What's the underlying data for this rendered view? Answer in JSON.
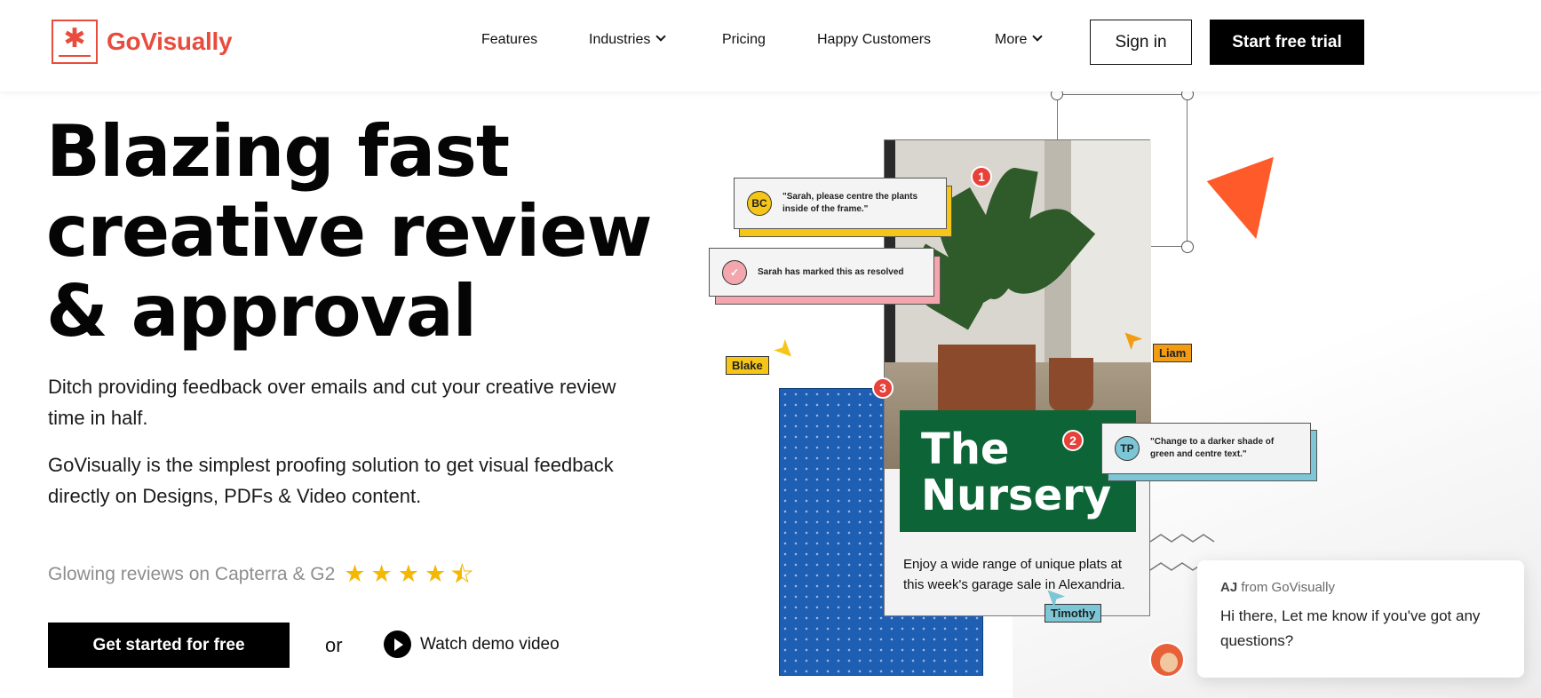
{
  "header": {
    "logo_text": "GoVisually",
    "logo_icon": "asterisk-logo-icon",
    "nav": [
      {
        "label": "Features",
        "dropdown": false
      },
      {
        "label": "Industries",
        "dropdown": true
      },
      {
        "label": "Pricing",
        "dropdown": false
      },
      {
        "label": "Happy Customers",
        "dropdown": false
      },
      {
        "label": "More",
        "dropdown": true
      }
    ],
    "signin_label": "Sign in",
    "trial_label": "Start free trial"
  },
  "hero": {
    "title_lines": [
      "Blazing fast",
      "creative review",
      "& approval"
    ],
    "paragraph_1": "Ditch providing feedback over emails and cut your creative review time in half.",
    "paragraph_2": "GoVisually is the simplest proofing solution to get visual feedback directly on Designs, PDFs & Video content.",
    "reviews_text": "Glowing reviews on Capterra & G2",
    "rating": 4.5,
    "rating_max": 5,
    "cta_primary": "Get started for free",
    "or_text": "or",
    "cta_video": "Watch demo video"
  },
  "illustration": {
    "comment_1": {
      "initials": "BC",
      "text": "\"Sarah, please centre the plants inside of the frame.\"",
      "badge": "1"
    },
    "comment_resolved": {
      "text": "Sarah has marked this as resolved"
    },
    "comment_2": {
      "initials": "TP",
      "text": "\"Change to a darker shade of green and centre text.\"",
      "badge": "2"
    },
    "badge_3": "3",
    "card_title": "The Nursery",
    "card_desc": "Enjoy a wide range of unique plats at this week's garage sale in Alexandria.",
    "tags": {
      "blake": "Blake",
      "liam": "Liam",
      "timothy": "Timothy"
    }
  },
  "chat": {
    "sender": "AJ",
    "from_text": "from GoVisually",
    "message": "Hi there,  Let me know if you've got any questions?"
  },
  "colors": {
    "brand": "#e84c3d",
    "star": "#f5b800",
    "nursery_green": "#0d6436",
    "blue_panel": "#1e5fb4",
    "triangle": "#ff5a2a"
  }
}
